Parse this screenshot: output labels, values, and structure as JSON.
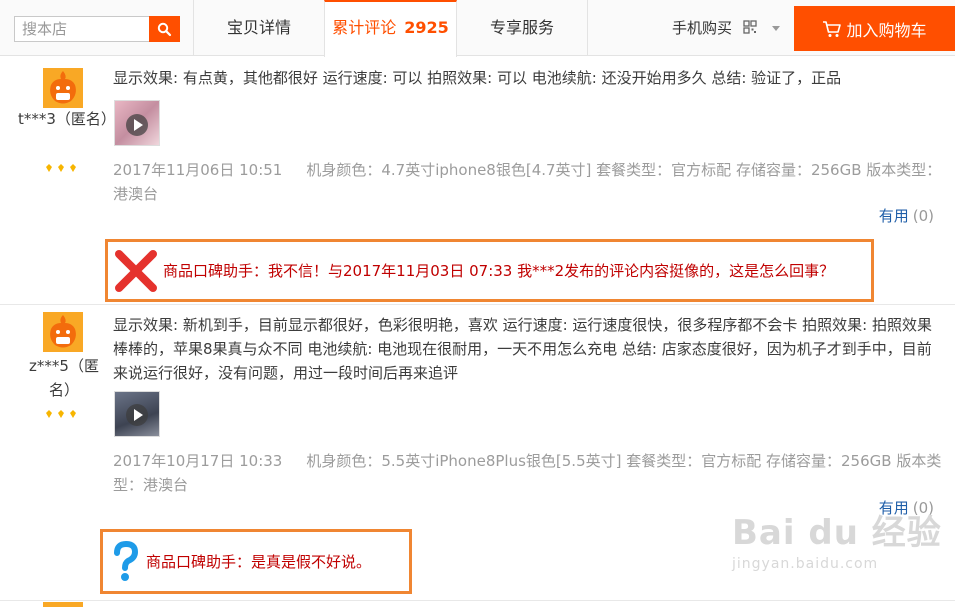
{
  "search": {
    "placeholder": "搜本店"
  },
  "tabs": [
    {
      "label": "宝贝详情"
    },
    {
      "label": "累计评论",
      "count": "2925"
    },
    {
      "label": "专享服务"
    }
  ],
  "mobile_buy": {
    "label": "手机购买"
  },
  "cart": {
    "label": "加入购物车"
  },
  "colors": {
    "accent": "#ff4f00",
    "highlight_border": "#f08632",
    "helper_text": "#c00000",
    "link": "#1f5ea8"
  },
  "reviews": [
    {
      "user": "t***3（匿名）",
      "text": "显示效果: 有点黄，其他都很好 运行速度: 可以 拍照效果: 可以 电池续航: 还没开始用多久 总结: 验证了，正品",
      "date": "2017年11月06日 10:51",
      "sku": "机身颜色：4.7英寸iphone8银色[4.7英寸]  套餐类型：官方标配  存储容量：256GB  版本类型：港澳台",
      "useful_label": "有用",
      "useful_count": "(0)",
      "helper_icon": "red-x-icon",
      "helper": "商品口碑助手：我不信！与2017年11月03日 07:33 我***2发布的评论内容挺像的，这是怎么回事？"
    },
    {
      "user": "z***5（匿名）",
      "text": "显示效果: 新机到手，目前显示都很好，色彩很明艳，喜欢 运行速度: 运行速度很快，很多程序都不会卡 拍照效果: 拍照效果棒棒的，苹果8果真与众不同 电池续航: 电池现在很耐用，一天不用怎么充电 总结: 店家态度很好，因为机子才到手中，目前来说运行很好，没有问题，用过一段时间后再来追评",
      "date": "2017年10月17日 10:33",
      "sku": "机身颜色：5.5英寸iPhone8Plus银色[5.5英寸]  套餐类型：官方标配  存储容量：256GB  版本类型：港澳台",
      "useful_label": "有用",
      "useful_count": "(0)",
      "helper_icon": "blue-question-icon",
      "helper": "商品口碑助手：是真是假不好说。"
    }
  ],
  "watermark": {
    "logo": "Bai du 经验",
    "url": "jingyan.baidu.com"
  }
}
